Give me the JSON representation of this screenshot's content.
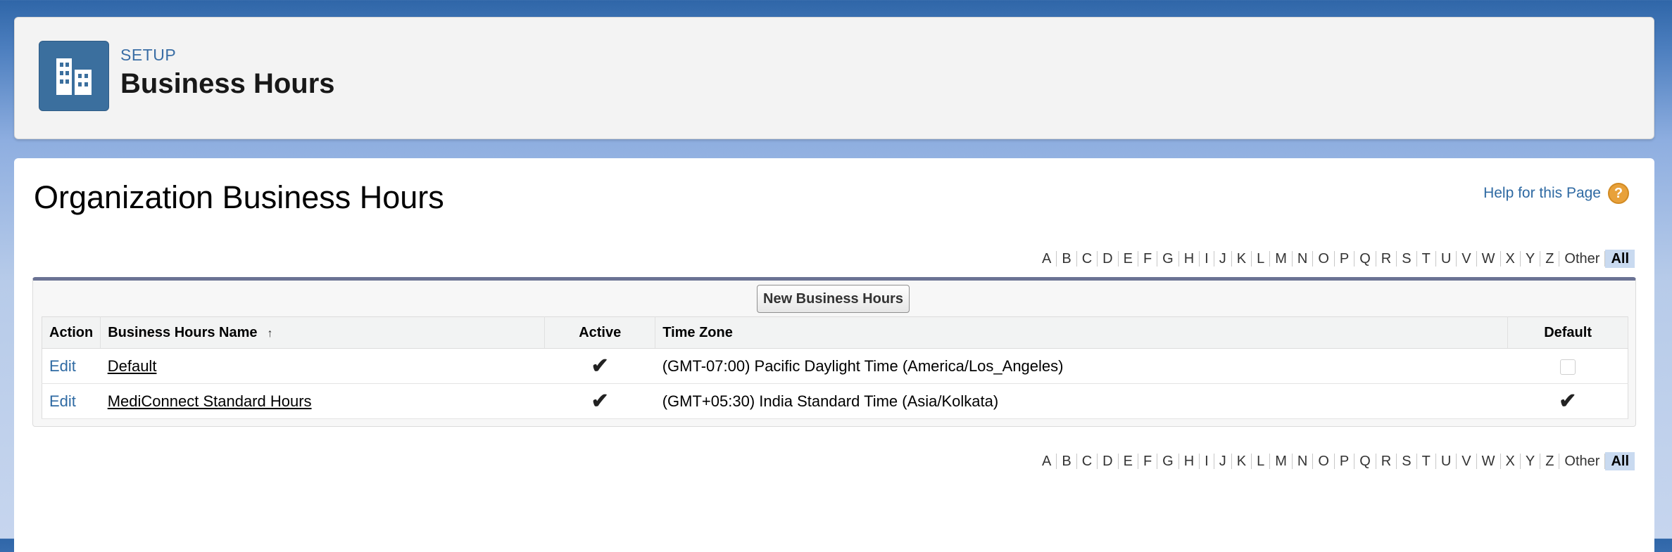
{
  "header": {
    "setup_label": "SETUP",
    "title": "Business Hours",
    "icon": "building-icon",
    "tile_color": "#3b6f9e"
  },
  "main": {
    "section_title": "Organization Business Hours",
    "help_link": "Help for this Page",
    "help_icon": "?",
    "alphabet": [
      "A",
      "B",
      "C",
      "D",
      "E",
      "F",
      "G",
      "H",
      "I",
      "J",
      "K",
      "L",
      "M",
      "N",
      "O",
      "P",
      "Q",
      "R",
      "S",
      "T",
      "U",
      "V",
      "W",
      "X",
      "Y",
      "Z",
      "Other"
    ],
    "alphabet_all": "All",
    "new_button": "New Business Hours",
    "columns": {
      "action": "Action",
      "name": "Business Hours Name",
      "name_sort_icon": "↑",
      "active": "Active",
      "timezone": "Time Zone",
      "default": "Default"
    },
    "rows": [
      {
        "action": "Edit",
        "name": "Default",
        "active": true,
        "timezone": "(GMT-07:00) Pacific Daylight Time (America/Los_Angeles)",
        "default": false
      },
      {
        "action": "Edit",
        "name": "MediConnect Standard Hours",
        "active": true,
        "timezone": "(GMT+05:30) India Standard Time (Asia/Kolkata)",
        "default": true
      }
    ],
    "check_glyph": "✔"
  }
}
